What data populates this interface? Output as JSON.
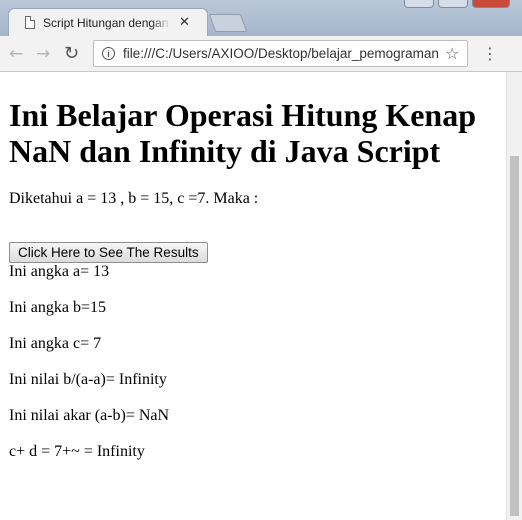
{
  "browser": {
    "tab_title": "Script Hitungan dengan Java Script",
    "url": "file:///C:/Users/AXIOO/Desktop/belajar_pemograman",
    "icons": {
      "back": "back-arrow-icon",
      "forward": "forward-arrow-icon",
      "reload": "reload-icon",
      "site_info": "info-icon",
      "bookmark": "star-icon",
      "menu": "kebab-menu-icon",
      "tab_close": "close-icon"
    }
  },
  "page": {
    "title": "Ini Belajar Operasi Hitung Kenap NaN dan Infinity di Java Script",
    "intro": "Diketahui a = 13 , b = 15, c =7. Maka :",
    "button_label": "Click Here to See The Results",
    "results": [
      "Ini angka a= 13",
      "Ini angka b=15",
      "Ini angka c= 7",
      "Ini nilai b/(a-a)= Infinity",
      "Ini nilai akar (a-b)= NaN",
      "c+ d = 7+~ = Infinity"
    ]
  }
}
